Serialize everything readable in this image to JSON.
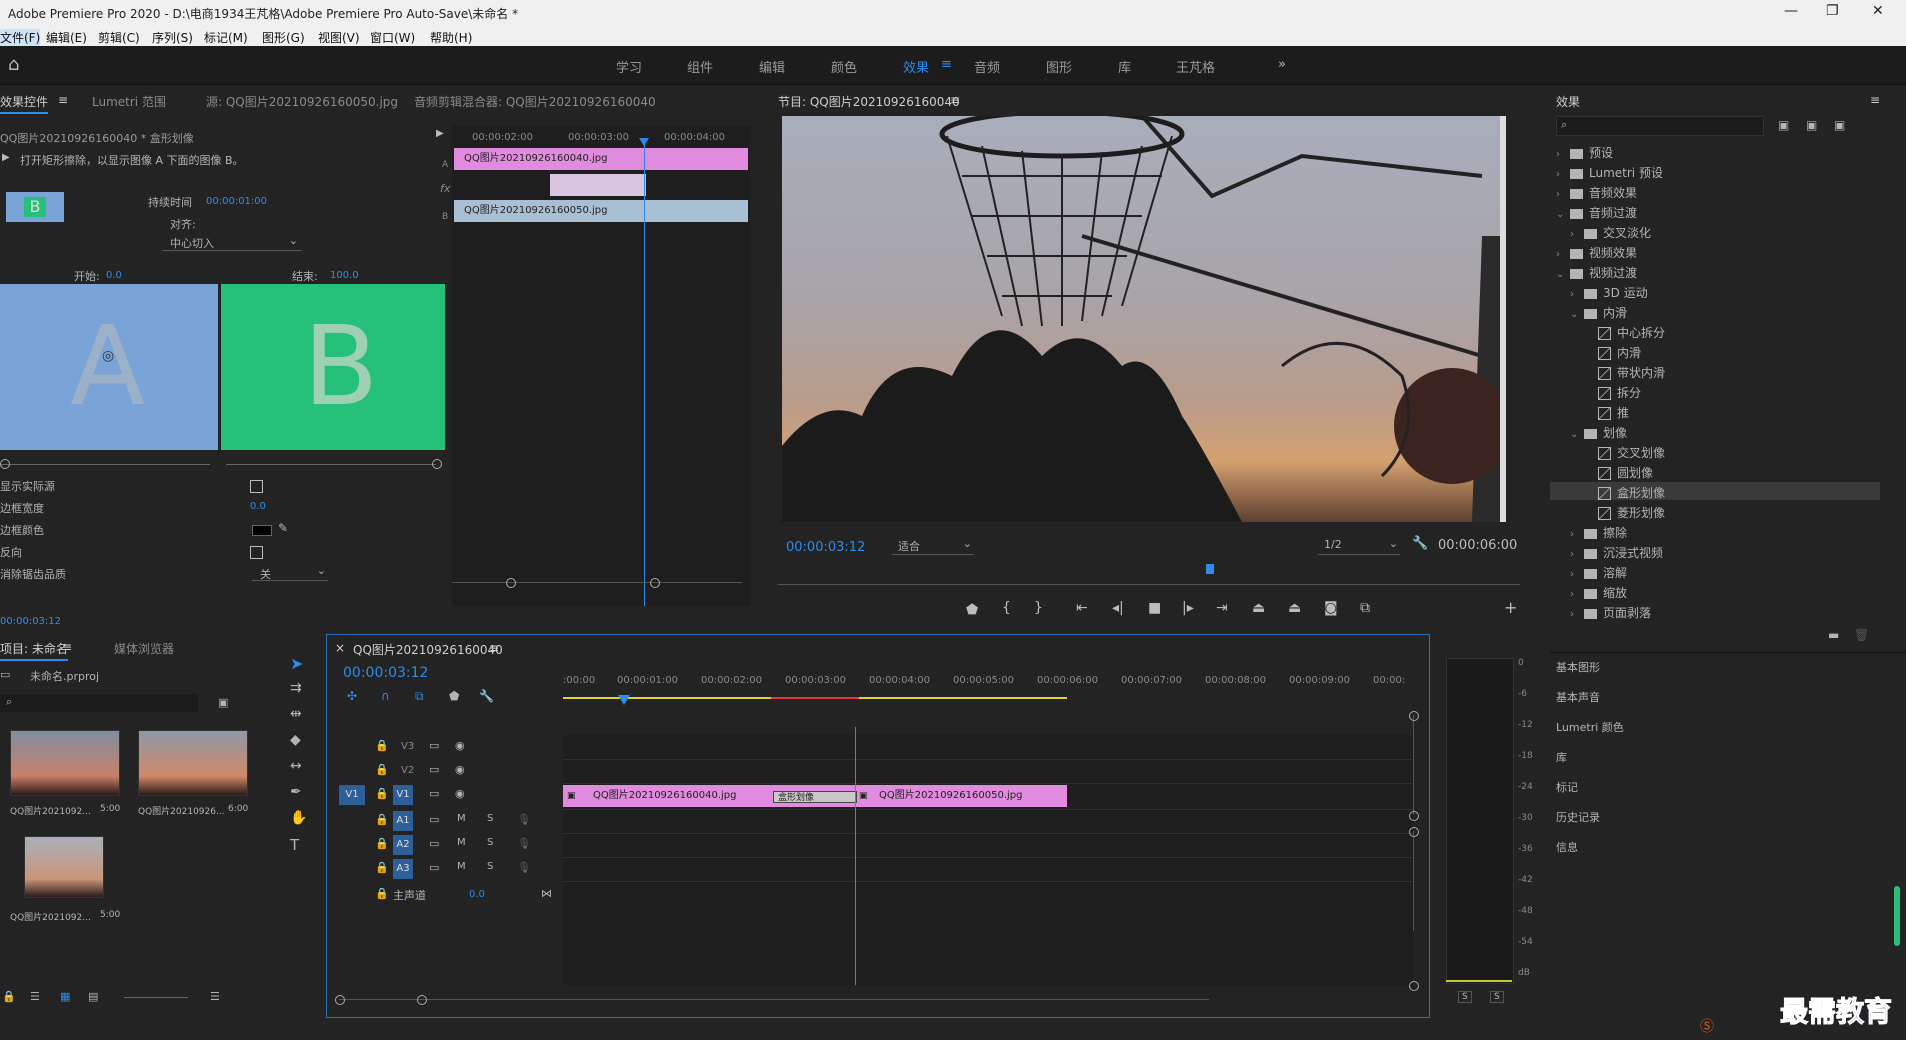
{
  "window": {
    "title": "Adobe Premiere Pro 2020 - D:\\电商1934王芃格\\Adobe Premiere Pro Auto-Save\\未命名 *"
  },
  "menu": [
    "文件(F)",
    "编辑(E)",
    "剪辑(C)",
    "序列(S)",
    "标记(M)",
    "图形(G)",
    "视图(V)",
    "窗口(W)",
    "帮助(H)"
  ],
  "workspaces": [
    "学习",
    "组件",
    "编辑",
    "颜色",
    "效果",
    "音频",
    "图形",
    "库",
    "王芃格"
  ],
  "workspace_more": "»",
  "effect_controls": {
    "tabs": [
      "效果控件",
      "Lumetri 范围",
      "源: QQ图片20210926160050.jpg",
      "音频剪辑混合器: QQ图片20210926160040"
    ],
    "clip_path": "QQ图片20210926160040 * 盒形划像",
    "description": "打开矩形擦除，以显示图像 A 下面的图像 B。",
    "thumb_letter": "B",
    "duration_label": "持续时间",
    "duration_value": "00:00:01:00",
    "align_label": "对齐:",
    "align_value": "中心切入",
    "start_label": "开始:",
    "start_value": "0.0",
    "end_label": "结束:",
    "end_value": "100.0",
    "preview_a": "A",
    "preview_b": "B",
    "properties": [
      {
        "label": "显示实际源",
        "value": ""
      },
      {
        "label": "边框宽度",
        "value": "0.0"
      },
      {
        "label": "边框颜色",
        "value": ""
      },
      {
        "label": "反向",
        "value": ""
      },
      {
        "label": "消除锯齿品质",
        "value": "关"
      }
    ],
    "timecode": "00:00:03:12",
    "mini_ruler": [
      "00:00:02:00",
      "00:00:03:00",
      "00:00:04:00"
    ],
    "mini_clip_a": "QQ图片20210926160040.jpg",
    "mini_clip_b": "QQ图片20210926160050.jpg",
    "fx_label": "fx",
    "a_label": "A",
    "b_label": "B"
  },
  "program": {
    "title": "节目: QQ图片20210926160040",
    "timecode": "00:00:03:12",
    "fit": "适合",
    "resolution": "1/2",
    "duration": "00:00:06:00"
  },
  "project": {
    "tabs": [
      "项目: 未命名",
      "媒体浏览器"
    ],
    "file": "未命名.prproj",
    "items": [
      {
        "name": "QQ图片2021092...",
        "dur": "5:00"
      },
      {
        "name": "QQ图片20210926...",
        "dur": "6:00"
      },
      {
        "name": "QQ图片2021092...",
        "dur": "5:00"
      }
    ]
  },
  "timeline": {
    "tab": "QQ图片20210926160040",
    "timecode": "00:00:03:12",
    "ruler": [
      ":00:00",
      "00:00:01:00",
      "00:00:02:00",
      "00:00:03:00",
      "00:00:04:00",
      "00:00:05:00",
      "00:00:06:00",
      "00:00:07:00",
      "00:00:08:00",
      "00:00:09:00",
      "00:00:"
    ],
    "video_tracks": [
      "V3",
      "V2",
      "V1"
    ],
    "audio_tracks": [
      "A1",
      "A2",
      "A3"
    ],
    "source_v1": "V1",
    "master_label": "主声道",
    "master_value": "0.0",
    "clip1": "QQ图片20210926160040.jpg",
    "clip2": "QQ图片20210926160050.jpg",
    "transition": "盒形划像",
    "m": "M",
    "s": "S"
  },
  "effects": {
    "title": "效果",
    "tree": [
      {
        "label": "预设",
        "level": 0,
        "type": "folder",
        "open": false
      },
      {
        "label": "Lumetri 预设",
        "level": 0,
        "type": "folder",
        "open": false
      },
      {
        "label": "音频效果",
        "level": 0,
        "type": "folder",
        "open": false
      },
      {
        "label": "音频过渡",
        "level": 0,
        "type": "folder",
        "open": true
      },
      {
        "label": "交叉淡化",
        "level": 1,
        "type": "folder",
        "open": false
      },
      {
        "label": "视频效果",
        "level": 0,
        "type": "folder",
        "open": false
      },
      {
        "label": "视频过渡",
        "level": 0,
        "type": "folder",
        "open": true
      },
      {
        "label": "3D 运动",
        "level": 1,
        "type": "folder",
        "open": false
      },
      {
        "label": "内滑",
        "level": 1,
        "type": "folder",
        "open": true
      },
      {
        "label": "中心拆分",
        "level": 2,
        "type": "fx"
      },
      {
        "label": "内滑",
        "level": 2,
        "type": "fx"
      },
      {
        "label": "带状内滑",
        "level": 2,
        "type": "fx"
      },
      {
        "label": "拆分",
        "level": 2,
        "type": "fx"
      },
      {
        "label": "推",
        "level": 2,
        "type": "fx"
      },
      {
        "label": "划像",
        "level": 1,
        "type": "folder",
        "open": true
      },
      {
        "label": "交叉划像",
        "level": 2,
        "type": "fx"
      },
      {
        "label": "圆划像",
        "level": 2,
        "type": "fx"
      },
      {
        "label": "盒形划像",
        "level": 2,
        "type": "fx",
        "selected": true
      },
      {
        "label": "菱形划像",
        "level": 2,
        "type": "fx"
      },
      {
        "label": "擦除",
        "level": 1,
        "type": "folder",
        "open": false
      },
      {
        "label": "沉浸式视频",
        "level": 1,
        "type": "folder",
        "open": false
      },
      {
        "label": "溶解",
        "level": 1,
        "type": "folder",
        "open": false
      },
      {
        "label": "缩放",
        "level": 1,
        "type": "folder",
        "open": false
      },
      {
        "label": "页面剥落",
        "level": 1,
        "type": "folder",
        "open": false
      }
    ]
  },
  "side_panels": [
    "基本图形",
    "基本声音",
    "Lumetri 颜色",
    "库",
    "标记",
    "历史记录",
    "信息"
  ],
  "meter_labels": [
    "0",
    "-6",
    "-12",
    "-18",
    "-24",
    "-30",
    "-36",
    "-42",
    "-48",
    "-54",
    "dB"
  ],
  "meter_s": "S",
  "watermark": "最需教育",
  "colors": {
    "accent": "#2d8ceb",
    "clip": "#e08bde",
    "clip_b": "#a9bfd4",
    "a_bg": "#7aa4d8",
    "b_bg": "#27c07a"
  }
}
